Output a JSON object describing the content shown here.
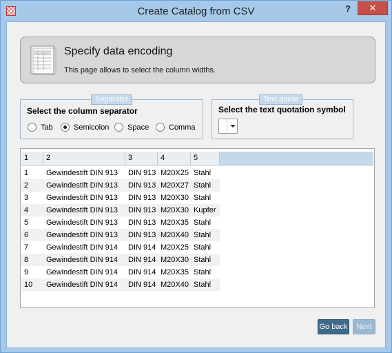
{
  "window": {
    "title": "Create Catalog from CSV",
    "help_label": "?",
    "close_label": "✕"
  },
  "header": {
    "title": "Specify data encoding",
    "description": "This page allows to select the column widths."
  },
  "separator": {
    "legend": "Separator",
    "title": "Select the column separator",
    "options": [
      {
        "label": "Tab",
        "checked": false
      },
      {
        "label": "Semicolon",
        "checked": true
      },
      {
        "label": "Space",
        "checked": false
      },
      {
        "label": "Comma",
        "checked": false
      }
    ]
  },
  "text_quote": {
    "legend": "Text quote",
    "title": "Select the text quotation symbol",
    "value": ""
  },
  "grid": {
    "columns": [
      "1",
      "2",
      "3",
      "4",
      "5"
    ],
    "rows": [
      [
        "1",
        "Gewindestift DIN 913",
        "DIN 913",
        "M20X25",
        "Stahl"
      ],
      [
        "2",
        "Gewindestift DIN 913",
        "DIN 913",
        "M20X27",
        "Stahl"
      ],
      [
        "3",
        "Gewindestift DIN 913",
        "DIN 913",
        "M20X30",
        "Stahl"
      ],
      [
        "4",
        "Gewindestift DIN 913",
        "DIN 913",
        "M20X30",
        "Kupfer"
      ],
      [
        "5",
        "Gewindestift DIN 913",
        "DIN 913",
        "M20X35",
        "Stahl"
      ],
      [
        "6",
        "Gewindestift DIN 913",
        "DIN 913",
        "M20X40",
        "Stahl"
      ],
      [
        "7",
        "Gewindestift DIN 914",
        "DIN 914",
        "M20X25",
        "Stahl"
      ],
      [
        "8",
        "Gewindestift DIN 914",
        "DIN 914",
        "M20X30",
        "Stahl"
      ],
      [
        "9",
        "Gewindestift DIN 914",
        "DIN 914",
        "M20X35",
        "Stahl"
      ],
      [
        "10",
        "Gewindestift DIN 914",
        "DIN 914",
        "M20X40",
        "Stahl"
      ]
    ]
  },
  "buttons": {
    "back": "Go back",
    "next": "Next"
  },
  "colors": {
    "title_bar": "#a6c9ea",
    "close_button": "#c7504b",
    "primary_button": "#3e6a8a",
    "disabled_button": "#9ab8cf",
    "grid_header": "#c4d8ea"
  },
  "icons": {
    "app": "catalog-app-icon",
    "header": "spreadsheet-document-icon"
  }
}
